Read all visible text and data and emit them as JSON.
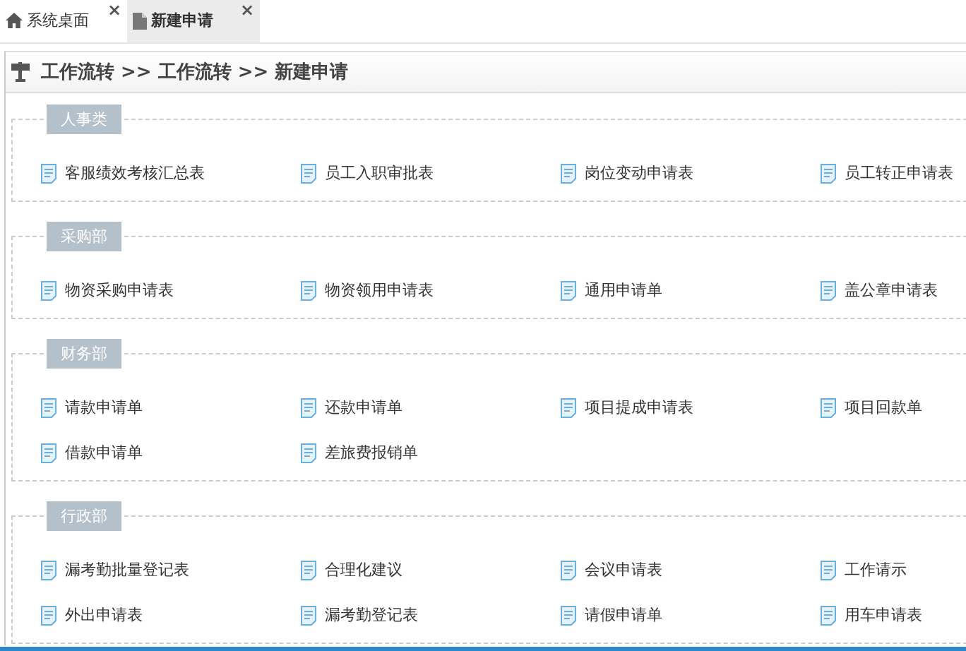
{
  "tabs": [
    {
      "label": "系统桌面",
      "selected": false,
      "close": "×"
    },
    {
      "label": "新建申请",
      "selected": true,
      "close": "×"
    }
  ],
  "breadcrumb": "工作流转 >> 工作流转 >> 新建申请",
  "groups": [
    {
      "title": "人事类",
      "items": [
        "客服绩效考核汇总表",
        "员工入职审批表",
        "岗位变动申请表",
        "员工转正申请表"
      ]
    },
    {
      "title": "采购部",
      "items": [
        "物资采购申请表",
        "物资领用申请表",
        "通用申请单",
        "盖公章申请表"
      ]
    },
    {
      "title": "财务部",
      "items": [
        "请款申请单",
        "还款申请单",
        "项目提成申请表",
        "项目回款单",
        "借款申请单",
        "差旅费报销单"
      ]
    },
    {
      "title": "行政部",
      "items": [
        "漏考勤批量登记表",
        "合理化建议",
        "会议申请表",
        "工作请示",
        "外出申请表",
        "漏考勤登记表",
        "请假申请单",
        "用车申请表"
      ]
    }
  ]
}
